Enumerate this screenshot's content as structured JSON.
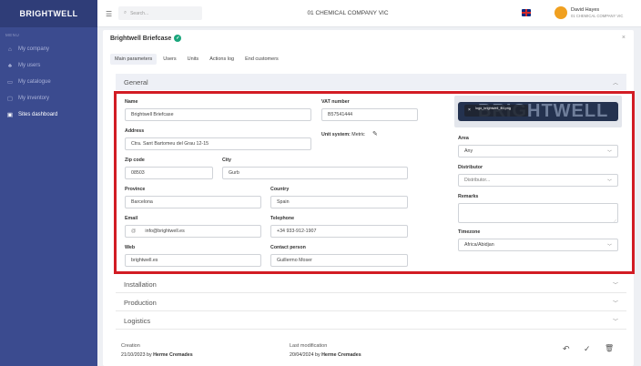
{
  "sidebar": {
    "brand": "BRIGHTWELL",
    "menu_title": "MENU",
    "items": [
      {
        "label": "My company",
        "icon": "home-icon"
      },
      {
        "label": "My users",
        "icon": "users-icon"
      },
      {
        "label": "My catalogue",
        "icon": "book-icon"
      },
      {
        "label": "My inventory",
        "icon": "inventory-icon"
      },
      {
        "label": "Sites dashboard",
        "icon": "dashboard-icon",
        "active": true
      }
    ]
  },
  "topbar": {
    "search_placeholder": "Search...",
    "company": "01 CHEMICAL COMPANY VIC",
    "user_name": "David Hayes",
    "user_company": "01 CHEMICAL COMPANY VIC"
  },
  "card": {
    "title": "Brightwell Briefcase",
    "tabs": [
      "Main parameters",
      "Users",
      "Units",
      "Actions log",
      "End customers"
    ]
  },
  "sections": {
    "general": "General",
    "installation": "Installation",
    "production": "Production",
    "logistics": "Logistics"
  },
  "form": {
    "name_label": "Name",
    "name_value": "Brightwell Briefcase",
    "vat_label": "VAT number",
    "vat_value": "B57541444",
    "address_label": "Address",
    "address_value": "Ctra. Sant Bartomeu del Grau 12-15",
    "unit_system_label": "Unit system:",
    "unit_system_value": "Metric",
    "zip_label": "Zip code",
    "zip_value": "08503",
    "city_label": "City",
    "city_value": "Gurb",
    "province_label": "Province",
    "province_value": "Barcelona",
    "country_label": "Country",
    "country_value": "Spain",
    "email_label": "Email",
    "email_prefix": "@",
    "email_value": "info@brightwell.es",
    "telephone_label": "Telephone",
    "telephone_value": "+34 933-912-1907",
    "web_label": "Web",
    "web_value": "brightwell.es",
    "contact_label": "Contact person",
    "contact_value": "Guillermo Moser",
    "area_label": "Area",
    "area_value": "Any",
    "distributor_label": "Distributor",
    "distributor_placeholder": "Distributor...",
    "remarks_label": "Remarks",
    "timezone_label": "Timezone",
    "timezone_value": "Africa/Abidjan",
    "logo_text": "BRIGHTWELL",
    "toast_text": "logo_brightwell_ffd.png"
  },
  "footer": {
    "creation_label": "Creation",
    "creation_date": "21/10/2023",
    "creation_by": "by",
    "creation_user": "Herme Cremades",
    "modification_label": "Last modification",
    "modification_date": "20/04/2024",
    "modification_by": "by",
    "modification_user": "Herme Cremades"
  }
}
